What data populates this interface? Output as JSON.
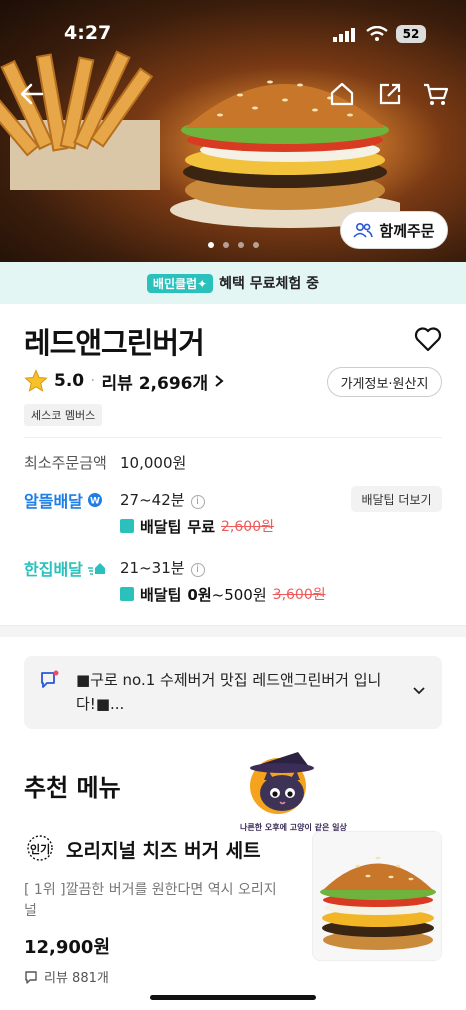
{
  "status_bar": {
    "time": "4:27",
    "battery": "52"
  },
  "hero": {
    "together_order_label": "함께주문",
    "slide_count": 4,
    "active_slide": 0
  },
  "banner": {
    "badge": "배민클럽✦",
    "text": "혜택 무료체험 중"
  },
  "store": {
    "name": "레드앤그린버거",
    "rating": "5.0",
    "reviews_label": "리뷰 2,696개",
    "info_button": "가게정보·원산지",
    "tag": "세스코 멤버스"
  },
  "delivery": {
    "min_order_label": "최소주문금액",
    "min_order_value": "10,000원",
    "alddeul": {
      "label": "알뜰배달",
      "time": "27~42분",
      "more_tips_label": "배달팁 더보기",
      "tip_label": "배달팁",
      "tip_value": "무료",
      "tip_original": "2,600원"
    },
    "hanjip": {
      "label": "한집배달",
      "time": "21~31분",
      "tip_label": "배달팁",
      "tip_value": "0원",
      "tip_range": "~500원",
      "tip_original": "3,600원"
    }
  },
  "notice": {
    "text": "■구로 no.1 수제버거 맛집 레드앤그린버거 입니다!■..."
  },
  "recommended": {
    "heading": "추천 메뉴",
    "watermark_text": "나른한 오후에 고양이 같은 일상",
    "popular_badge": "인기",
    "item": {
      "name": "오리지널 치즈 버거 세트",
      "description": "[ 1위 ]깔끔한 버거를 원한다면 역시 오리지널",
      "price": "12,900원",
      "reviews": "리뷰 881개"
    }
  },
  "colors": {
    "brand_mint": "#2ac1bc",
    "strike_red": "#f05a5a",
    "alddeul_blue": "#1f7de6"
  }
}
